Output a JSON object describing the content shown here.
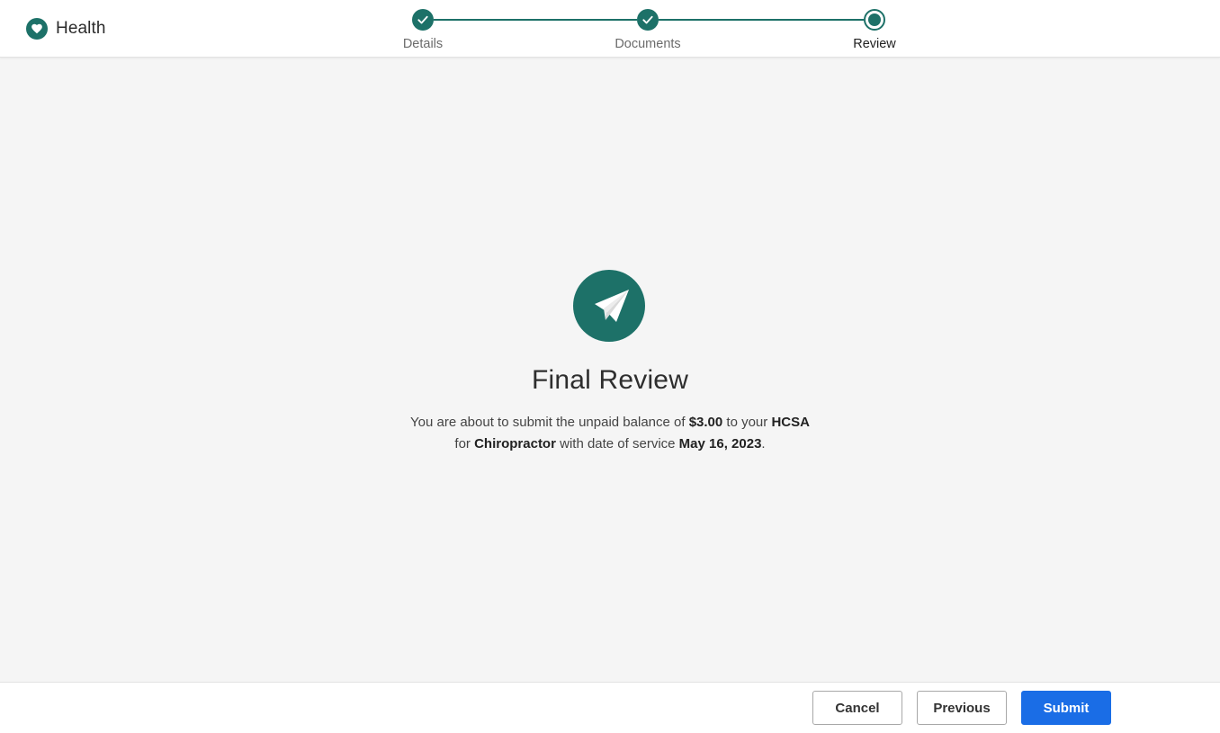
{
  "brand": {
    "name": "Health",
    "icon": "heart-icon",
    "color": "#1d7168"
  },
  "stepper": {
    "steps": [
      {
        "label": "Details",
        "status": "complete"
      },
      {
        "label": "Documents",
        "status": "complete"
      },
      {
        "label": "Review",
        "status": "current"
      }
    ]
  },
  "main": {
    "icon": "paper-plane-icon",
    "title": "Final Review",
    "message": {
      "pre_amount": "You are about to submit the unpaid balance of ",
      "amount": "$3.00",
      "pre_account": " to your ",
      "account": "HCSA",
      "pre_provider": "for ",
      "provider": "Chiropractor",
      "pre_date": " with date of service ",
      "date": "May 16, 2023",
      "end": "."
    }
  },
  "footer": {
    "cancel_label": "Cancel",
    "previous_label": "Previous",
    "submit_label": "Submit"
  },
  "colors": {
    "accent": "#1d7168",
    "primary_button": "#1a6de6",
    "background": "#f5f5f5"
  }
}
